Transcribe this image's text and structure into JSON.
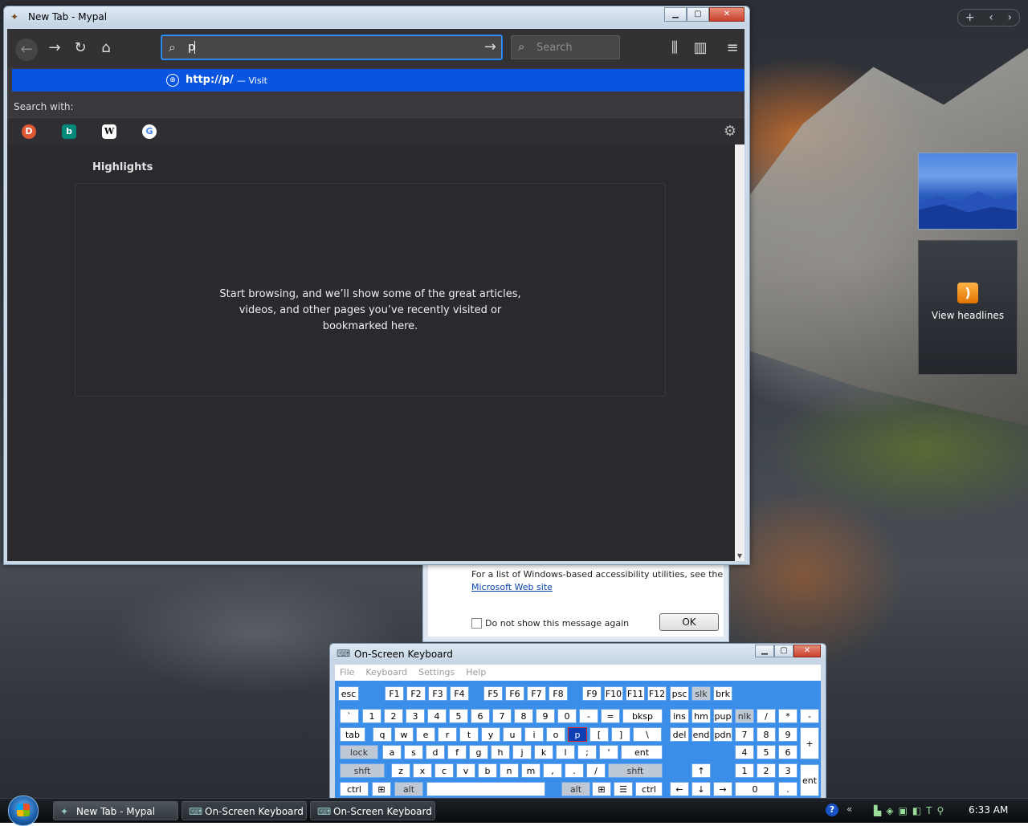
{
  "browser": {
    "window_title": "New Tab - Mypal",
    "url_value": "p",
    "search_placeholder": "Search",
    "suggestion_url": "http://p/",
    "suggestion_action": "— Visit",
    "search_with_label": "Search with:",
    "engines": [
      "duckduckgo-icon",
      "bing-icon",
      "wikipedia-icon",
      "google-icon"
    ],
    "highlights_title": "Highlights",
    "highlights_empty_line1": "Start browsing, and we’ll show some of the great articles,",
    "highlights_empty_line2": "videos, and other pages you’ve recently visited or",
    "highlights_empty_line3": "bookmarked here."
  },
  "a11y_dialog": {
    "text": "For a list of Windows-based accessibility utilities, see the",
    "link": "Microsoft Web site",
    "checkbox_label": "Do not show this message again",
    "ok_label": "OK"
  },
  "gadgets": {
    "feed_label": "View headlines"
  },
  "osk": {
    "title": "On-Screen Keyboard",
    "menu": [
      "File",
      "Keyboard",
      "Settings",
      "Help"
    ],
    "pressed_key": "p"
  },
  "taskbar": {
    "buttons": [
      "New Tab - Mypal",
      "On-Screen Keyboard",
      "On-Screen Keyboard"
    ],
    "clock": "6:33 AM"
  },
  "colors": {
    "accent": "#0a55e0",
    "browser_bg": "#2a2a2e"
  }
}
